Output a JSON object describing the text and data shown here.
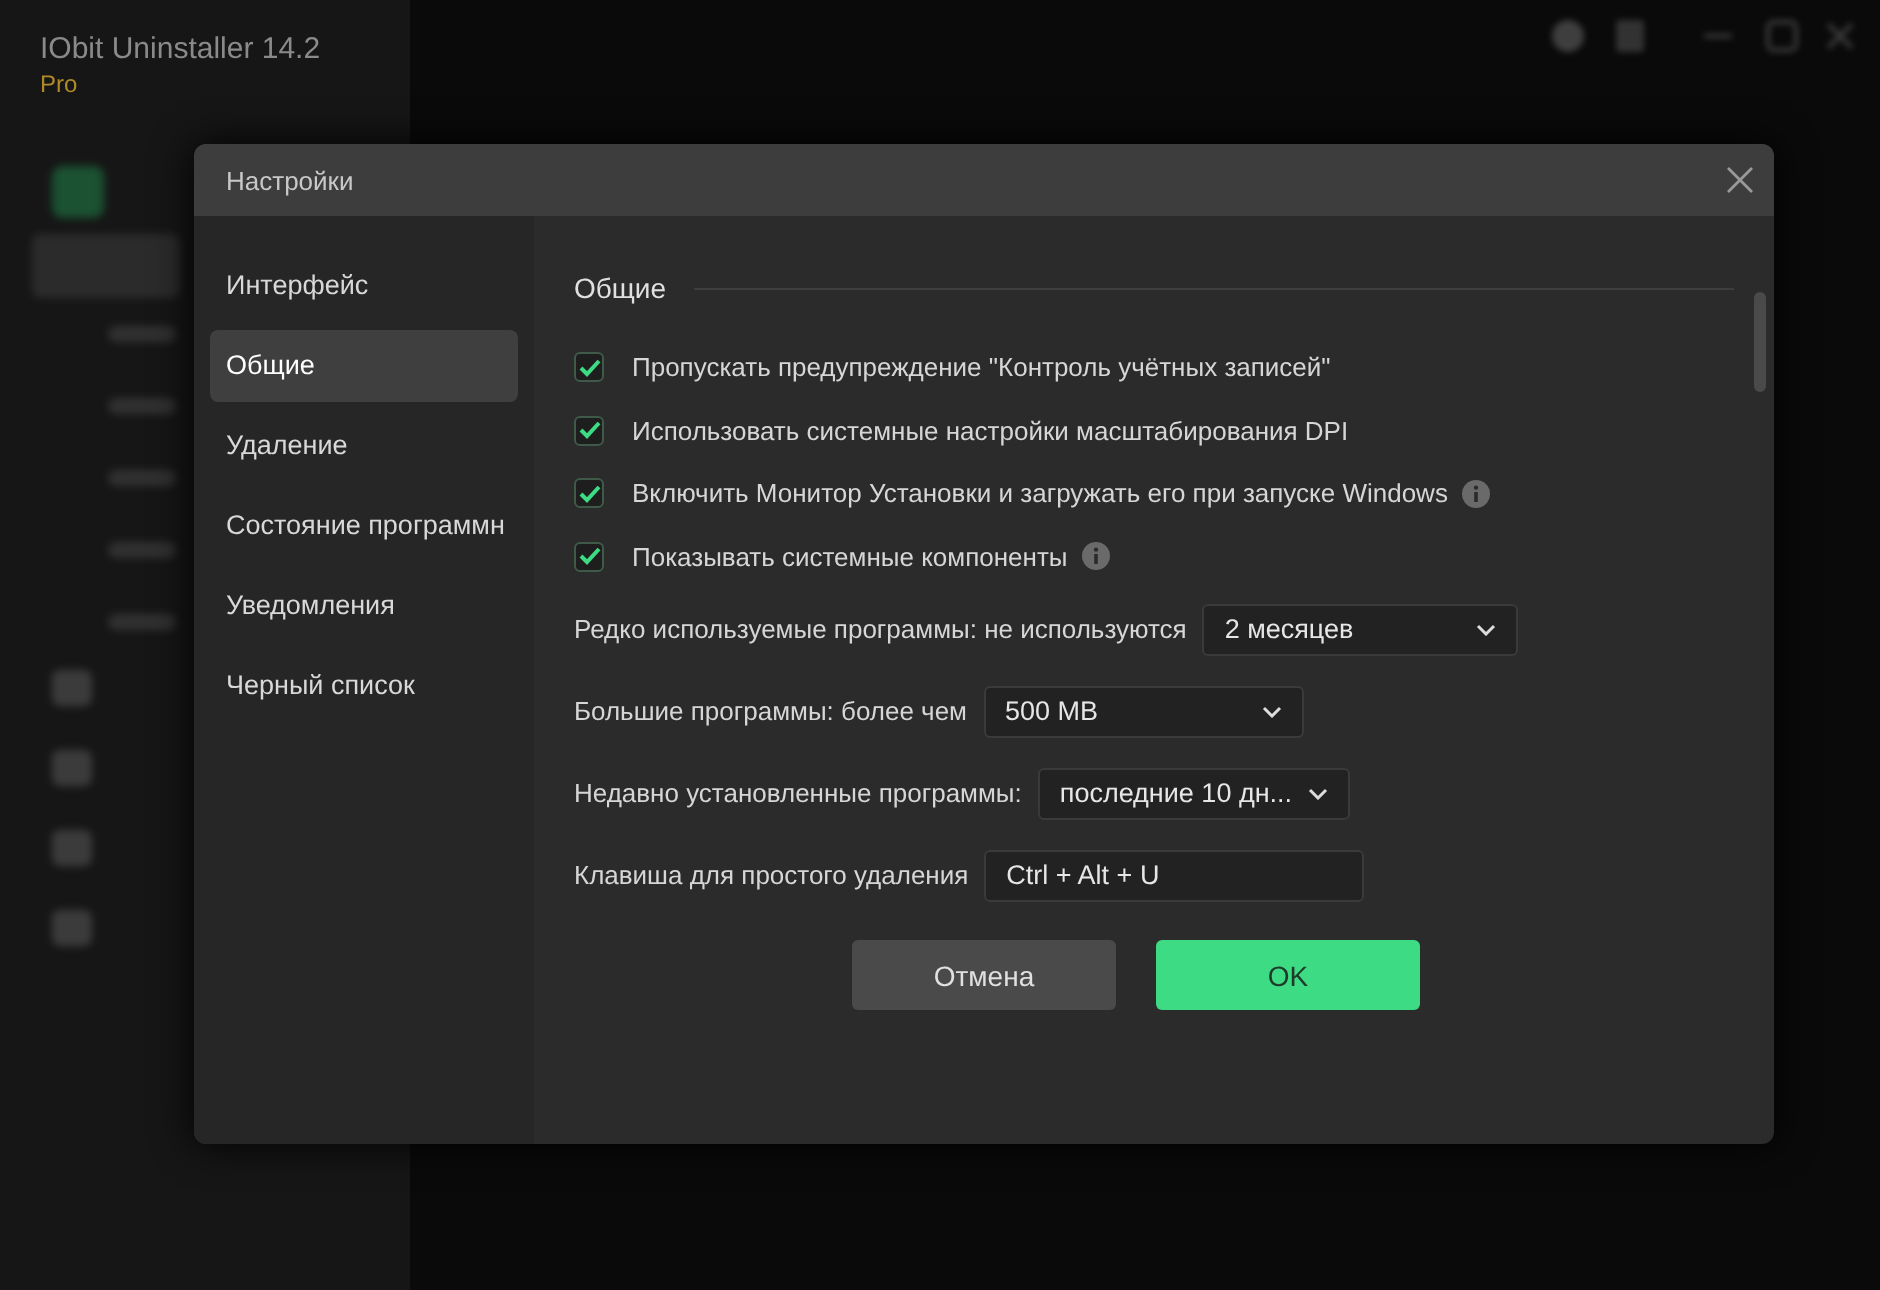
{
  "app": {
    "title": "IObit Uninstaller 14.2",
    "edition": "Pro"
  },
  "dialog": {
    "title": "Настройки",
    "sidebar": {
      "items": [
        {
          "label": "Интерфейс",
          "selected": false
        },
        {
          "label": "Общие",
          "selected": true
        },
        {
          "label": "Удаление",
          "selected": false
        },
        {
          "label": "Состояние программн",
          "selected": false
        },
        {
          "label": "Уведомления",
          "selected": false
        },
        {
          "label": "Черный список",
          "selected": false
        }
      ]
    },
    "section": {
      "title": "Общие"
    },
    "options": [
      {
        "label": "Пропускать предупреждение \"Контроль учётных записей\"",
        "checked": true,
        "info": false
      },
      {
        "label": "Использовать системные настройки масштабирования DPI",
        "checked": true,
        "info": false
      },
      {
        "label": "Включить Монитор Установки и загружать его при запуске Windows",
        "checked": true,
        "info": true
      },
      {
        "label": "Показывать системные компоненты",
        "checked": true,
        "info": true
      }
    ],
    "settings": [
      {
        "label": "Редко используемые программы: не используются",
        "value": "2 месяцев",
        "kind": "select"
      },
      {
        "label": "Большие программы: более чем",
        "value": "500 MB",
        "kind": "select"
      },
      {
        "label": "Недавно установленные программы:",
        "value": "последние 10 дн...",
        "kind": "select"
      },
      {
        "label": "Клавиша для простого удаления",
        "value": "Ctrl + Alt + U",
        "kind": "hotkey"
      }
    ],
    "buttons": [
      {
        "label": "Отмена",
        "kind": "secondary"
      },
      {
        "label": "OK",
        "kind": "primary"
      }
    ]
  }
}
